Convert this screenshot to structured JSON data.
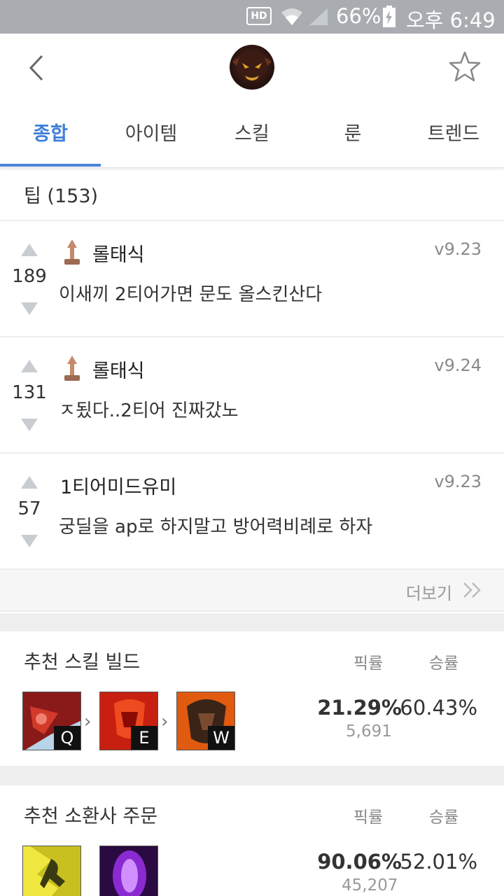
{
  "status_bar": {
    "hd": "HD",
    "battery": "66%",
    "time": "오후 6:49"
  },
  "tabs": [
    "종합",
    "아이템",
    "스킬",
    "룬",
    "트렌드"
  ],
  "tips": {
    "header": "팁 (153)",
    "items": [
      {
        "votes": "189",
        "author": "롤태식",
        "version": "v9.23",
        "text": "이새끼 2티어가면 문도 올스킨산다",
        "has_icon": true
      },
      {
        "votes": "131",
        "author": "롤태식",
        "version": "v9.24",
        "text": "ㅈ됬다..2티어 진짜갔노",
        "has_icon": true
      },
      {
        "votes": "57",
        "author": "1티어미드유미",
        "version": "v9.23",
        "text": "궁딜을 ap로 하지말고 방어력비례로 하자",
        "has_icon": false
      }
    ],
    "more": "더보기"
  },
  "skill_build": {
    "title": "추천 스킬 빌드",
    "pick_header": "픽률",
    "win_header": "승률",
    "skills": [
      {
        "key": "Q",
        "icon": "cleaver-skill-icon"
      },
      {
        "key": "E",
        "icon": "masochism-skill-icon"
      },
      {
        "key": "W",
        "icon": "heart-zapper-skill-icon"
      }
    ],
    "pick_rate": "21.29%",
    "pick_count": "5,691",
    "win_rate": "60.43%"
  },
  "summoner_spells": {
    "title": "추천 소환사 주문",
    "pick_header": "픽률",
    "win_header": "승률",
    "spells": [
      {
        "icon": "ghost-spell-icon"
      },
      {
        "icon": "teleport-spell-icon"
      }
    ],
    "pick_rate": "90.06%",
    "pick_count": "45,207",
    "win_rate": "52.01%"
  },
  "colors": {
    "accent": "#4a86dc",
    "status_bar": "#a9adb1"
  }
}
